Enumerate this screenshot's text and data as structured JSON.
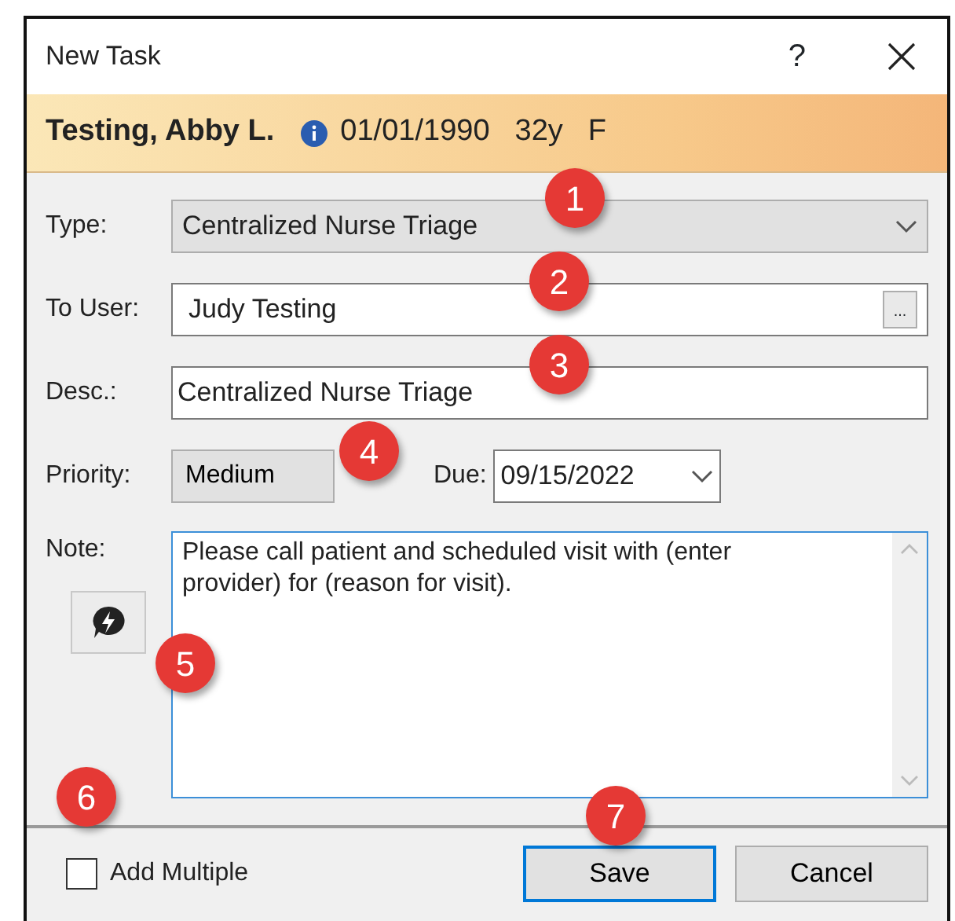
{
  "window": {
    "title": "New Task",
    "help": "?"
  },
  "patient": {
    "name": "Testing, Abby L.",
    "dob": "01/01/1990",
    "age": "32y",
    "sex": "F"
  },
  "fields": [
    {
      "kind": "select",
      "label": "Type:",
      "value": "Centralized Nurse Triage",
      "callout": "1"
    },
    {
      "kind": "lookup",
      "label": "To User:",
      "value": "Judy Testing",
      "button": "...",
      "callout": "2"
    },
    {
      "kind": "text",
      "label": "Desc.:",
      "value": "Centralized Nurse Triage",
      "callout": "3"
    }
  ],
  "priority": {
    "label": "Priority:",
    "value": "Medium",
    "callout": "4"
  },
  "due": {
    "label": "Due:",
    "value": "09/15/2022"
  },
  "note": {
    "label": "Note:",
    "value": "Please call patient and scheduled visit with (enter provider) for (reason for visit).",
    "callout": "5"
  },
  "add_multiple": {
    "label": "Add Multiple",
    "checked": false,
    "callout": "6"
  },
  "buttons": [
    {
      "label": "Save",
      "focused": true,
      "callout": "7"
    },
    {
      "label": "Cancel",
      "focused": false
    }
  ]
}
